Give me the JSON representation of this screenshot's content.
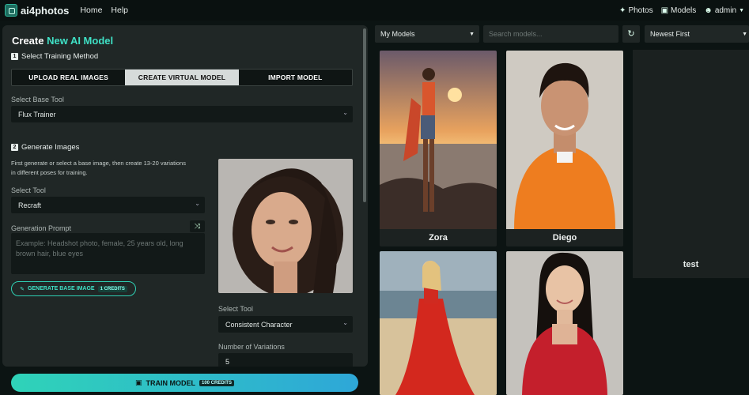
{
  "app": {
    "brand": "ai4photos",
    "nav_home": "Home",
    "nav_help": "Help"
  },
  "topnav": {
    "photos": "Photos",
    "models": "Models",
    "user": "admin"
  },
  "form": {
    "title_prefix": "Create ",
    "title_accent": "New AI Model",
    "step1_num": "1",
    "step1_label": "Select Training Method",
    "tabs": [
      {
        "label": "UPLOAD REAL IMAGES",
        "active": false
      },
      {
        "label": "CREATE VIRTUAL MODEL",
        "active": true
      },
      {
        "label": "IMPORT MODEL",
        "active": false
      }
    ],
    "base_tool_label": "Select Base Tool",
    "base_tool_value": "Flux Trainer",
    "step2_num": "2",
    "step2_label": "Generate Images",
    "step2_desc": "First generate or select a base image, then create 13-20 variations in different poses for training.",
    "tool_label": "Select Tool",
    "tool_value": "Recraft",
    "prompt_label": "Generation Prompt",
    "prompt_placeholder": "Example: Headshot photo, female, 25 years old, long brown hair, blue eyes",
    "generate_button": "GENERATE BASE IMAGE",
    "generate_credits": "1 CREDITS",
    "tool2_label": "Select Tool",
    "tool2_value": "Consistent Character",
    "variations_label": "Number of Variations",
    "variations_value": "5",
    "train_button": "TRAIN MODEL",
    "train_credits": "100 CREDITS"
  },
  "gallery": {
    "filter_value": "My Models",
    "search_placeholder": "Search models...",
    "sort_value": "Newest First",
    "models": [
      {
        "name": "Zora"
      },
      {
        "name": "Diego"
      },
      {
        "name": "test"
      },
      {
        "name": ""
      },
      {
        "name": ""
      }
    ]
  },
  "colors": {
    "accent": "#3fe0c5",
    "panel": "#202726",
    "background": "#0c1413"
  }
}
